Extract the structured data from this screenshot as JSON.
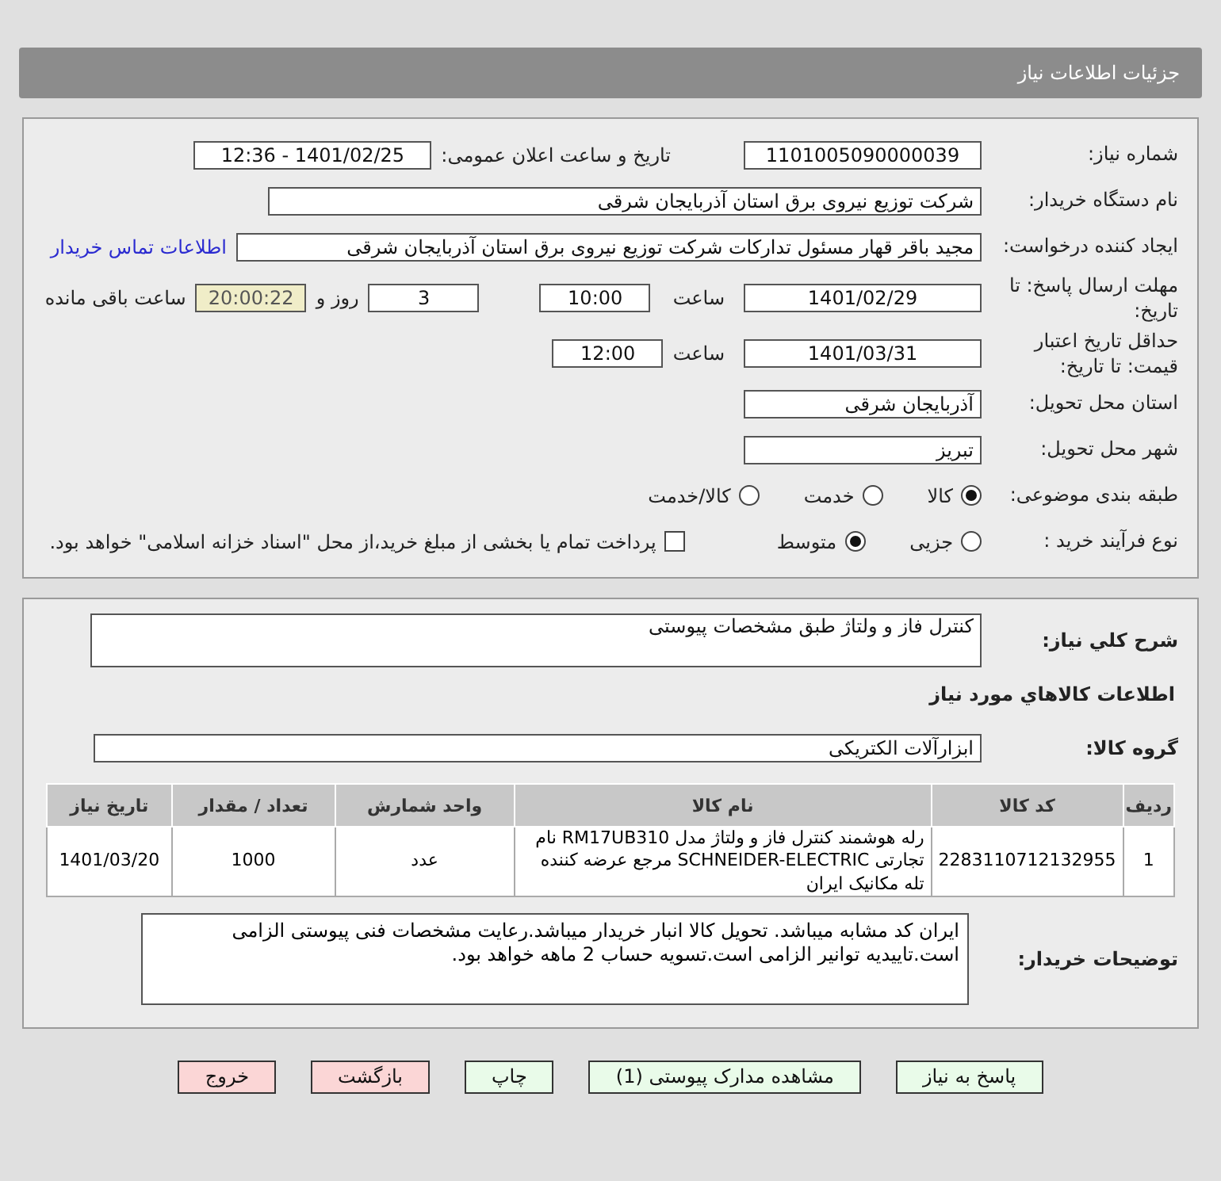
{
  "header": {
    "title": "جزئیات اطلاعات نیاز"
  },
  "need_number": {
    "label": "شماره نیاز:",
    "value": "1101005090000039"
  },
  "announce": {
    "label": "تاریخ و ساعت اعلان عمومی:",
    "value": "1401/02/25 - 12:36"
  },
  "buyer_org": {
    "label": "نام دستگاه خریدار:",
    "value": "شرکت توزیع نیروی برق استان آذربایجان شرقی"
  },
  "creator": {
    "label": "ایجاد کننده درخواست:",
    "value": "مجید باقر قهار مسئول تدارکات شرکت توزیع نیروی برق استان آذربایجان شرقی",
    "link": "اطلاعات تماس خریدار"
  },
  "deadline": {
    "label": "مهلت ارسال پاسخ: تا تاریخ:",
    "date": "1401/02/29",
    "time_label": "ساعت",
    "time": "10:00",
    "days": "3",
    "days_label": "روز و",
    "remaining": "20:00:22",
    "remaining_label": "ساعت باقی مانده"
  },
  "validity": {
    "label": "حداقل تاریخ اعتبار قیمت: تا تاریخ:",
    "date": "1401/03/31",
    "time_label": "ساعت",
    "time": "12:00"
  },
  "province": {
    "label": "استان محل تحویل:",
    "value": "آذربایجان شرقی"
  },
  "city": {
    "label": "شهر محل تحویل:",
    "value": "تبریز"
  },
  "category": {
    "label": "طبقه بندی موضوعی:",
    "options": [
      {
        "label": "کالا",
        "selected": true
      },
      {
        "label": "خدمت",
        "selected": false
      },
      {
        "label": "کالا/خدمت",
        "selected": false
      }
    ]
  },
  "process": {
    "label": "نوع فرآیند خرید :",
    "options": [
      {
        "label": "جزیی",
        "selected": false
      },
      {
        "label": "متوسط",
        "selected": true
      }
    ],
    "payment": {
      "label": "پرداخت تمام یا بخشی از مبلغ خرید،از محل \"اسناد خزانه اسلامی\" خواهد بود.",
      "checked": false
    }
  },
  "description": {
    "label": "شرح کلي نياز:",
    "value": "کنترل فاز و ولتاژ طبق مشخصات پیوستی"
  },
  "goods_heading": "اطلاعات کالاهاي مورد نياز",
  "goods_group": {
    "label": "گروه کالا:",
    "value": "ابزارآلات الکتریکی"
  },
  "table": {
    "columns": [
      "ردیف",
      "کد کالا",
      "نام کالا",
      "واحد شمارش",
      "تعداد / مقدار",
      "تاریخ نیاز"
    ],
    "rows": [
      [
        "1",
        "2283110712132955",
        "رله هوشمند کنترل فاز و ولتاژ مدل RM17UB310 نام تجارتی SCHNEIDER-ELECTRIC مرجع عرضه کننده تله مکانیک ایران",
        "عدد",
        "1000",
        "1401/03/20"
      ]
    ]
  },
  "buyer_notes": {
    "label": "توضیحات خریدار:",
    "value": "ایران کد مشابه میباشد. تحویل کالا انبار خریدار میباشد.رعایت مشخصات فنی پیوستی الزامی است.تاییدیه توانیر الزامی است.تسویه حساب 2 ماهه خواهد بود."
  },
  "buttons": [
    {
      "label": "پاسخ به نیاز",
      "kind": "primary"
    },
    {
      "label": "مشاهده مدارک پیوستی (1)",
      "kind": "primary"
    },
    {
      "label": "چاپ",
      "kind": "primary"
    },
    {
      "label": "بازگشت",
      "kind": "danger"
    },
    {
      "label": "خروج",
      "kind": "danger"
    }
  ]
}
